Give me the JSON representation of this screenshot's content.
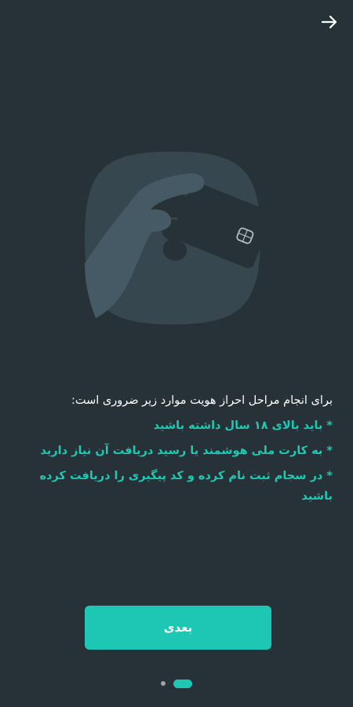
{
  "header": {
    "back_icon": "arrow-right-icon"
  },
  "illustration": {
    "icon": "hand-holding-card-icon"
  },
  "content": {
    "intro": "برای انجام مراحل احراز هویت موارد زیر ضروری است:",
    "requirements": [
      "* باید بالای ۱۸ سال داشته باشید",
      "* به کارت ملی هوشمند یا رسید دریافت آن نیاز دارید",
      "* در سجام ثبت نام کرده و کد پیگیری را دریافت کرده باشید"
    ]
  },
  "actions": {
    "next_label": "بعدی"
  },
  "pager": {
    "total": 2,
    "current": 1
  },
  "colors": {
    "background": "#263238",
    "accent": "#1dc7b4",
    "text": "#ffffff"
  }
}
